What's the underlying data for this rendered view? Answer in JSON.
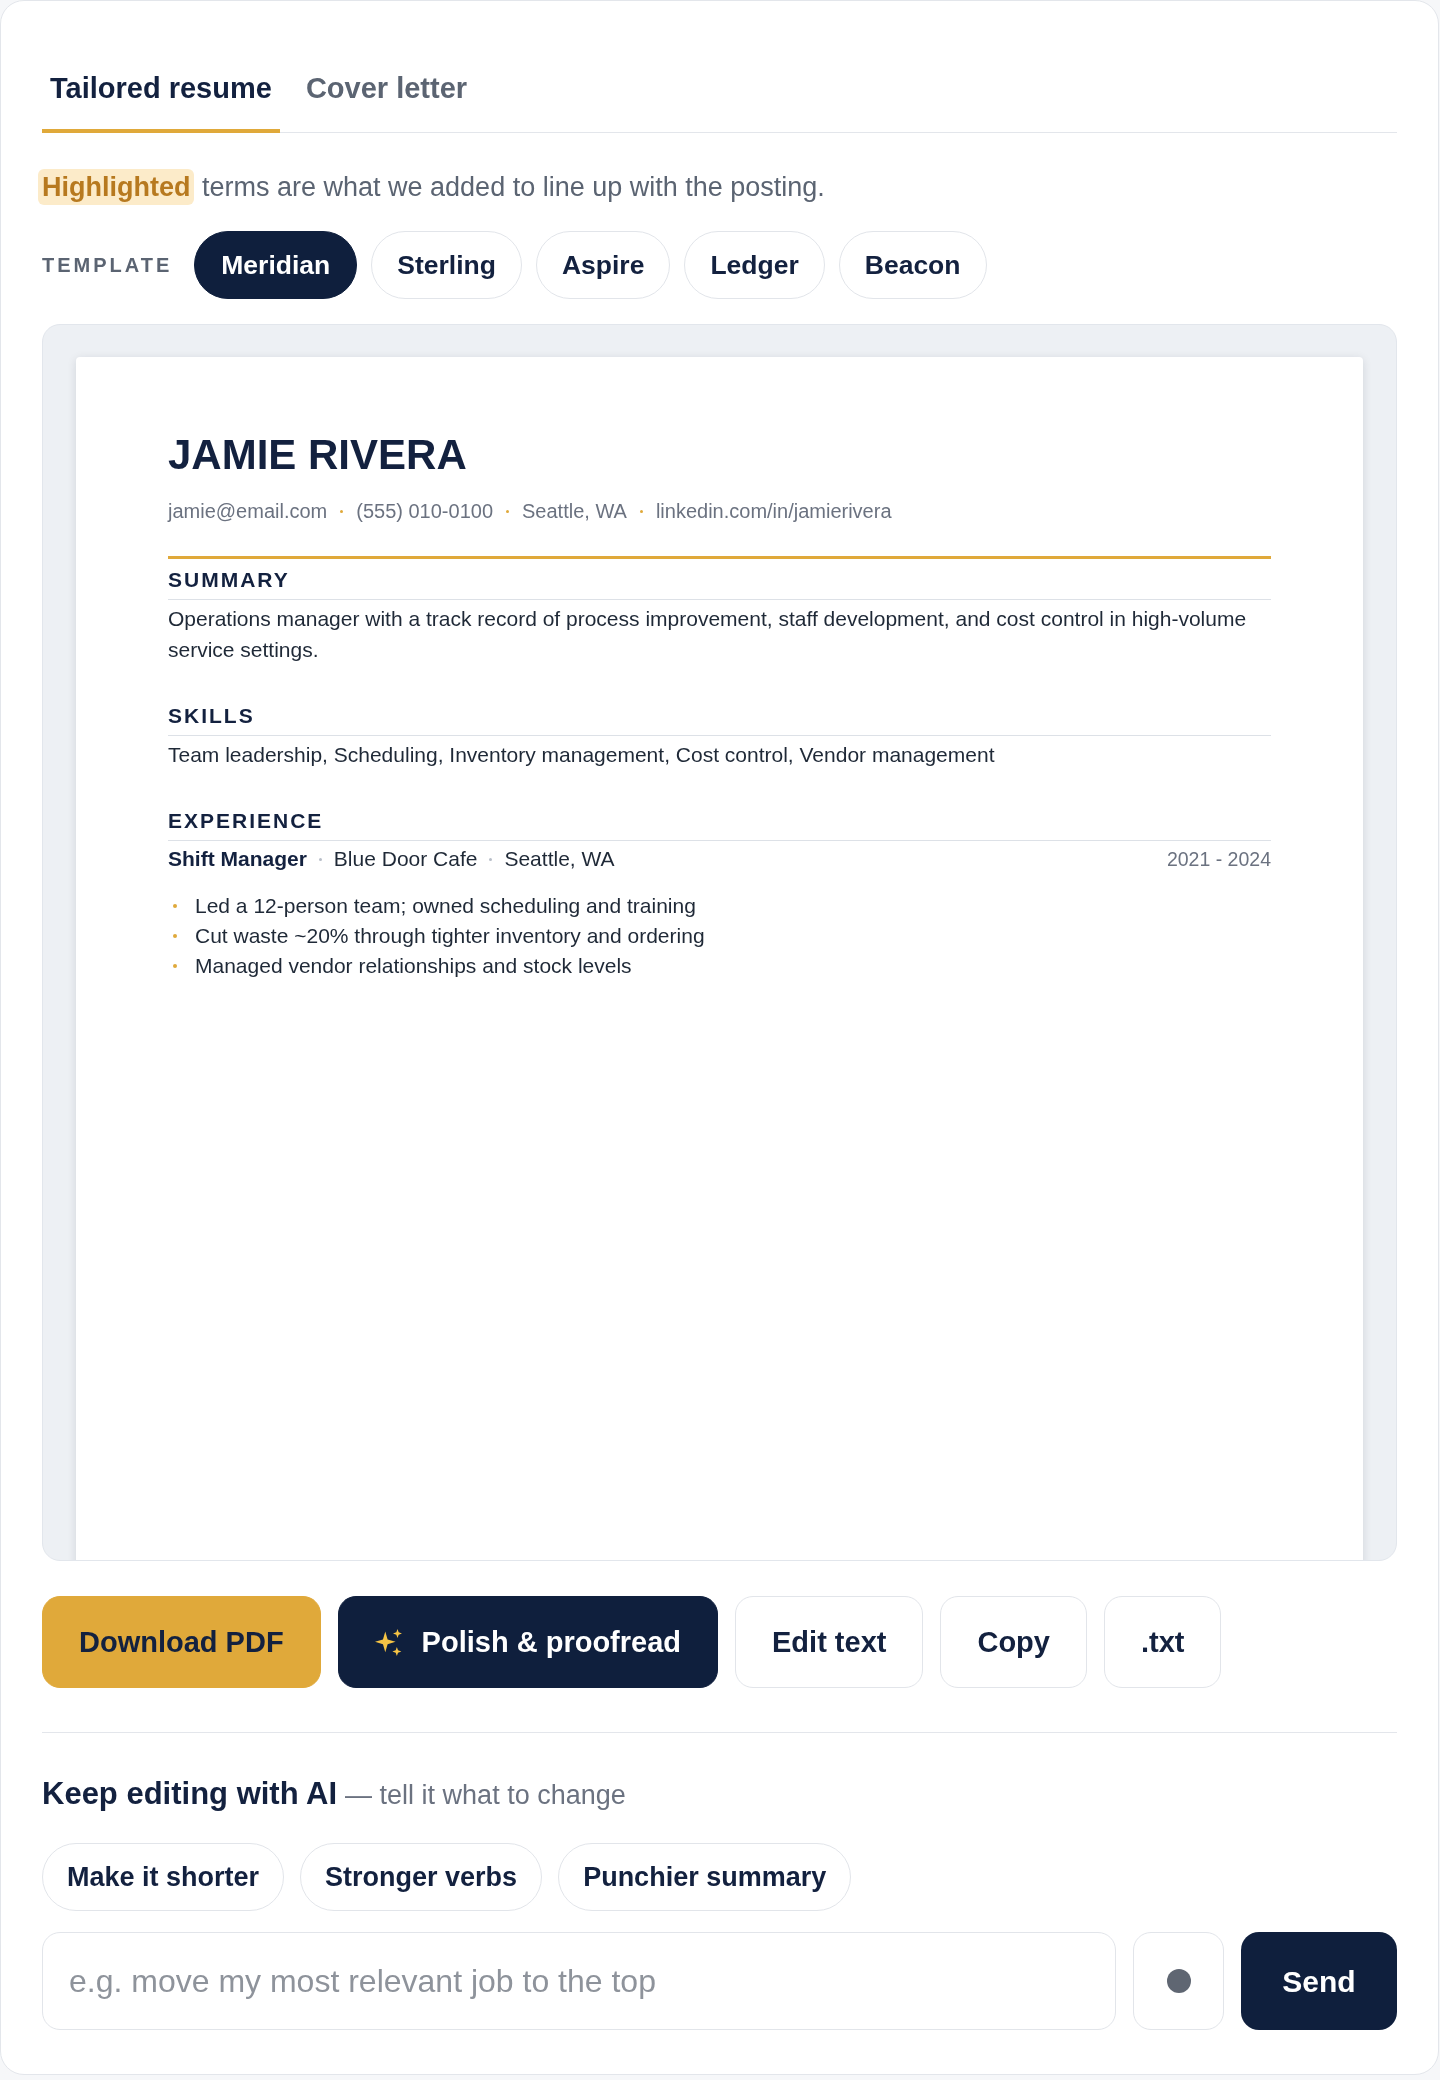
{
  "tabs": [
    {
      "label": "Tailored resume",
      "selected": true
    },
    {
      "label": "Cover letter",
      "selected": false
    }
  ],
  "notice": "**Highlighted** terms are what we added to line up with the posting.",
  "template_picker": {
    "label": "TEMPLATE",
    "options": [
      {
        "label": "Meridian",
        "selected": true
      },
      {
        "label": "Sterling",
        "selected": false
      },
      {
        "label": "Aspire",
        "selected": false
      },
      {
        "label": "Ledger",
        "selected": false
      },
      {
        "label": "Beacon",
        "selected": false
      }
    ]
  },
  "resume": {
    "name": "JAMIE RIVERA",
    "contacts": [
      "jamie@email.com",
      "(555) 010-0100",
      "Seattle, WA",
      "linkedin.com/in/jamierivera"
    ],
    "sections": [
      {
        "kind": "text",
        "heading": "SUMMARY",
        "text": "Operations manager with a track record of process improvement, staff development, and cost control in high-volume service settings."
      },
      {
        "kind": "text",
        "heading": "SKILLS",
        "text": "Team leadership, Scheduling, Inventory management, Cost control, Vendor management"
      },
      {
        "kind": "experience",
        "heading": "EXPERIENCE",
        "jobs": [
          {
            "title": "Shift Manager",
            "company": "Blue Door Cafe",
            "location": "Seattle, WA",
            "dates": "2021 - 2024",
            "bullets": [
              "Led a 12-person team; owned scheduling and training",
              "Cut waste ~20% through tighter inventory and ordering",
              "Managed vendor relationships and stock levels"
            ]
          }
        ]
      }
    ]
  },
  "actions": [
    {
      "kind": "accent",
      "label": "Download PDF"
    },
    {
      "kind": "ai",
      "label": "Polish & proofread"
    },
    {
      "kind": "outline",
      "label": "Edit text"
    },
    {
      "kind": "outline",
      "label": "Copy"
    },
    {
      "kind": "outline",
      "label": ".txt"
    }
  ],
  "ai_editor": {
    "title": "Keep editing with AI",
    "hint": "— tell it what to change",
    "suggestions": [
      "Make it shorter",
      "Stronger verbs",
      "Punchier summary"
    ],
    "input": {
      "placeholder": "e.g. move my most relevant job to the top"
    },
    "send_label": "Send"
  }
}
